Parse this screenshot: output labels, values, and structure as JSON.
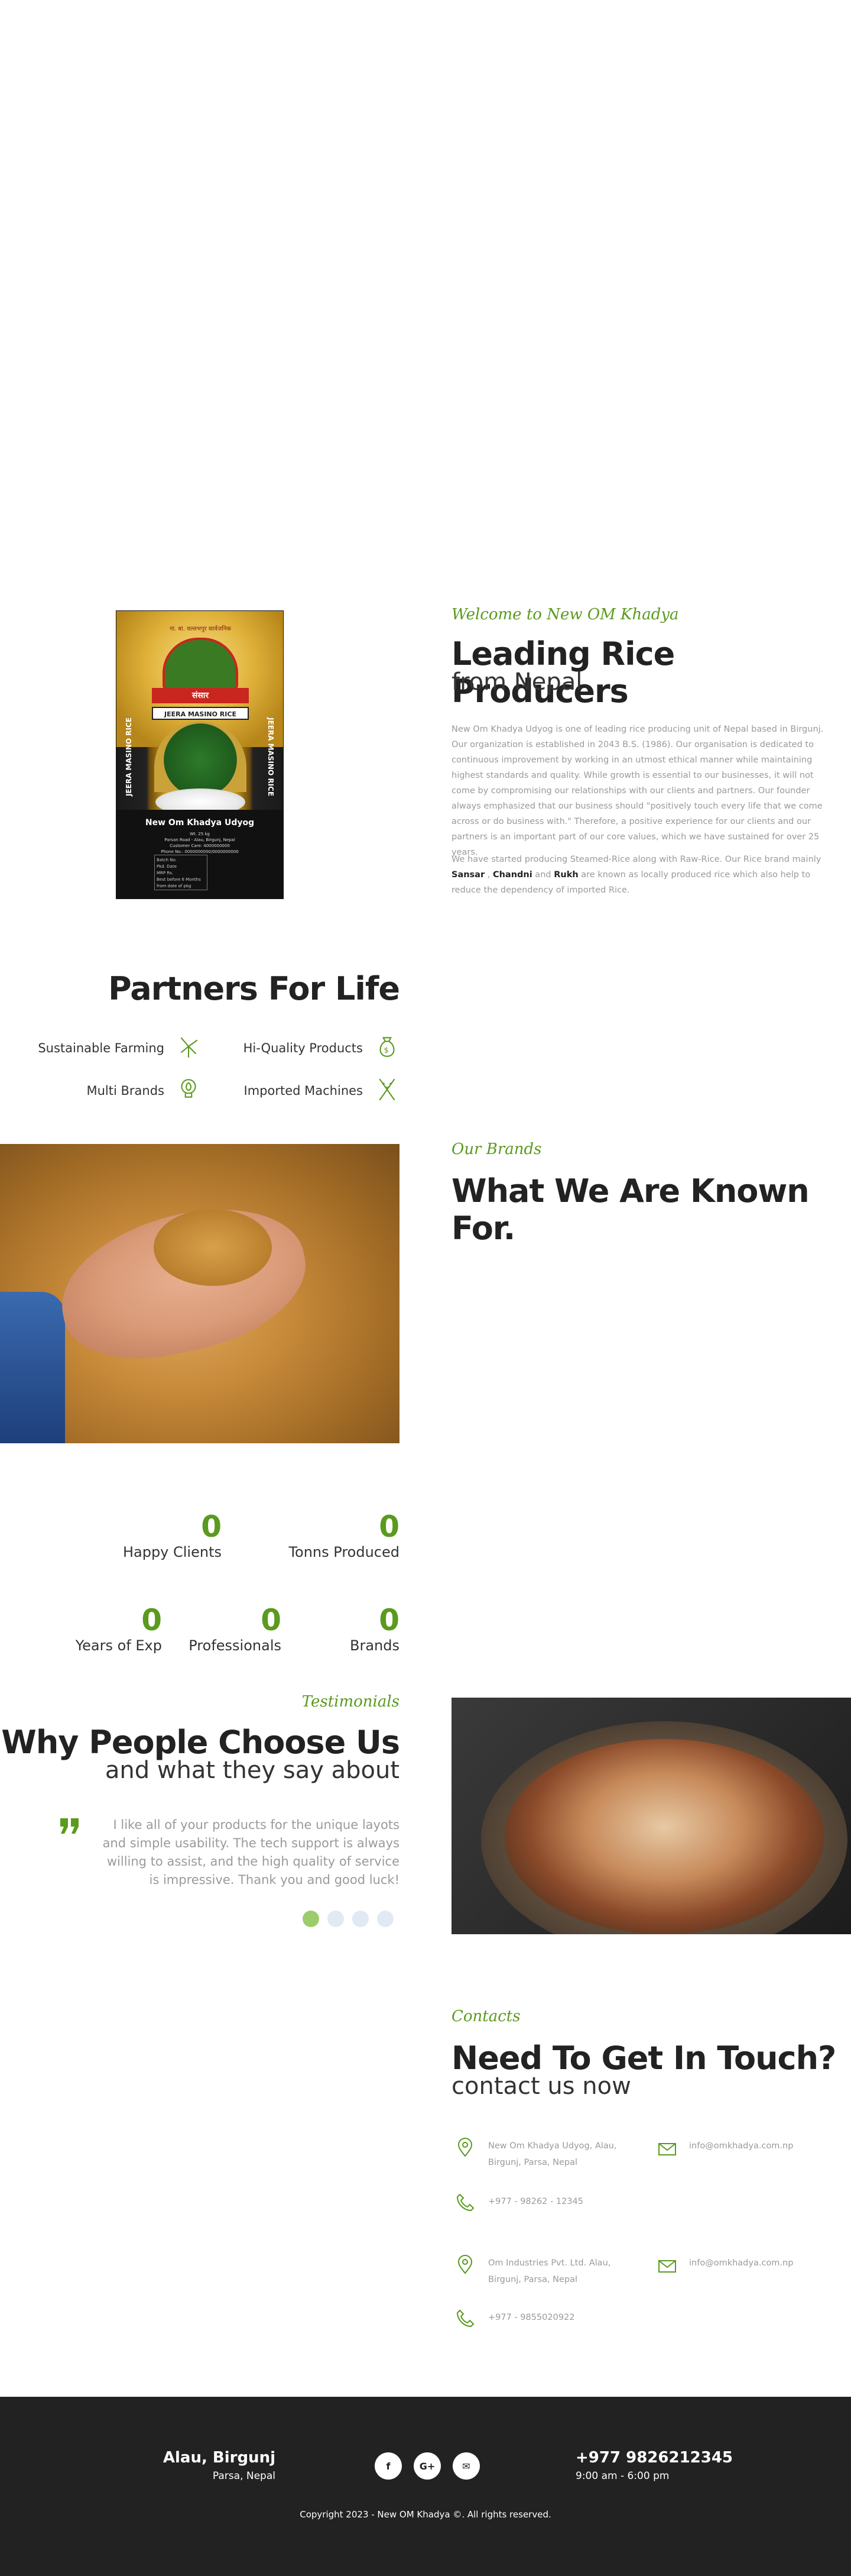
{
  "about": {
    "eyebrow": "Welcome to New OM Khadya",
    "title": "Leading Rice Producers",
    "subtitle": "from Nepal",
    "paragraph1": "New Om Khadya Udyog is one of leading rice producing unit of Nepal based in Birgunj. Our organization is established in 2043 B.S. (1986). Our organisation is dedicated to continuous improvement by working in an utmost ethical manner while maintaining highest standards and quality. While growth is essential to our businesses, it will not come by compromising our relationships with our clients and partners. Our founder always emphasized that our business should \"positively touch every life that we come across or do business with.\" Therefore, a positive experience for our clients and our partners is an important part of our core values, which we have sustained for over 25 years.",
    "paragraph2_a": "We have started producing Steamed-Rice along with Raw-Rice. Our Rice brand mainly ",
    "brand1": "Sansar",
    "sep1": " , ",
    "brand2": "Chandni",
    "and": " and ",
    "brand3": "Rukh",
    "paragraph2_b": " are known as locally produced rice which also help to reduce the dependency of imported Rice."
  },
  "bag": {
    "top_text": "ना. बा. वल्लभपुर सार्वजनिक",
    "banner": "संसार",
    "label": "JEERA MASINO RICE",
    "side_left": "JEERA MASINO RICE",
    "side_right": "JEERA MASINO RICE",
    "weight": "Wt. 25 kg",
    "brand": "New Om Khadya Udyog",
    "small1": "Parsan Road - Alau, Birgunj, Nepal",
    "small2": "Customer Care: 4000000000",
    "small3": "Phone No.: 0000000000/0000000000",
    "info1": "Batch No.",
    "info2": "Pkd. Date",
    "info3": "MRP Rs.",
    "info4": "Best before 6 Months from date of pkg"
  },
  "partners": {
    "title": "Partners For Life",
    "items": [
      {
        "label": "Sustainable Farming",
        "icon": "windmill-icon"
      },
      {
        "label": "Hi-Quality Products",
        "icon": "money-bag-icon"
      },
      {
        "label": "Multi Brands",
        "icon": "leaf-bulb-icon"
      },
      {
        "label": "Imported Machines",
        "icon": "wheat-icon"
      }
    ]
  },
  "brands": {
    "eyebrow": "Our Brands",
    "title": "What We Are Known For."
  },
  "counters": [
    {
      "value": "0",
      "label": "Happy Clients"
    },
    {
      "value": "0",
      "label": "Tonns Produced"
    },
    {
      "value": "0",
      "label": "Years of Exp"
    },
    {
      "value": "0",
      "label": "Professionals"
    },
    {
      "value": "0",
      "label": "Brands"
    }
  ],
  "testimonials": {
    "eyebrow": "Testimonials",
    "title": "Why People Choose Us",
    "subtitle": "and what they say about",
    "quote": "I like all of your products for the unique layots and simple usability. The tech support is always willing to assist, and the high quality of service is impressive. Thank you and good luck!",
    "active_slide": 1,
    "slides": 4
  },
  "contact": {
    "eyebrow": "Contacts",
    "title": "Need To Get In Touch?",
    "subtitle": "contact us now",
    "office1_address": "New Om Khadya Udyog, Alau, Birgunj, Parsa, Nepal",
    "office1_phone": "+977 - 98262 - 12345",
    "office1_email": "info@omkhadya.com.np",
    "office2_address": "Om Industries Pvt. Ltd. Alau, Birgunj, Parsa, Nepal",
    "office2_phone": "+977 - 9855020922",
    "office2_email": "info@omkhadya.com.np"
  },
  "footer": {
    "city": "Alau, Birgunj",
    "district": "Parsa, Nepal",
    "phone": "+977 9826212345",
    "hours": "9:00 am - 6:00 pm",
    "social": [
      "f",
      "G+",
      "✉"
    ],
    "copyright": "Copyright 2023 - New OM Khadya ©. All rights reserved."
  },
  "colors": {
    "accent": "#5a9a1e",
    "footer_bg": "#222222"
  }
}
